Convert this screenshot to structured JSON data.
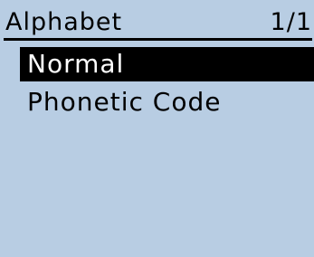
{
  "screen": {
    "title": "Alphabet",
    "page_indicator": "1/1",
    "background_color": "#b8cde3",
    "selection_color": "#000000"
  },
  "menu": {
    "items": [
      {
        "label": "Normal",
        "selected": true
      },
      {
        "label": "Phonetic Code",
        "selected": false
      }
    ]
  }
}
